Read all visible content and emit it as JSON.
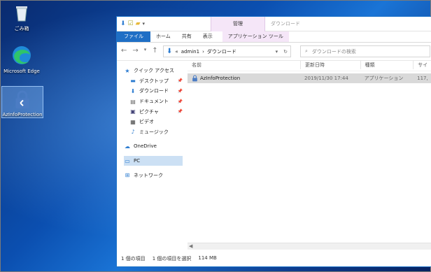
{
  "desktop": {
    "icons": [
      {
        "label": "ごみ箱",
        "icon": "recycle-bin-icon"
      },
      {
        "label": "Microsoft Edge",
        "icon": "edge-icon"
      },
      {
        "label": "AzInfoProtection",
        "icon": "azip-lock-icon"
      }
    ]
  },
  "window": {
    "context_tab": "管理",
    "title": "ダウンロード",
    "ribbon_tabs": [
      "ファイル",
      "ホーム",
      "共有",
      "表示",
      "アプリケーション ツール"
    ],
    "address": {
      "root": "«",
      "parts": [
        "admin1",
        "ダウンロード"
      ],
      "separator": "›"
    },
    "search_placeholder": "ダウンロードの検索",
    "nav_pane": {
      "quick_access": "クイック アクセス",
      "quick_items": [
        "デスクトップ",
        "ダウンロード",
        "ドキュメント",
        "ピクチャ",
        "ビデオ",
        "ミュージック"
      ],
      "onedrive": "OneDrive",
      "pc": "PC",
      "network": "ネットワーク"
    },
    "columns": [
      "名前",
      "更新日時",
      "種類",
      "サイズ"
    ],
    "files": [
      {
        "name": "AzInfoProtection",
        "modified": "2019/11/30 17:44",
        "type": "アプリケーション",
        "size": "117,"
      }
    ],
    "status": {
      "count": "1 個の項目",
      "selected": "1 個の項目を選択",
      "size": "114 MB"
    }
  }
}
